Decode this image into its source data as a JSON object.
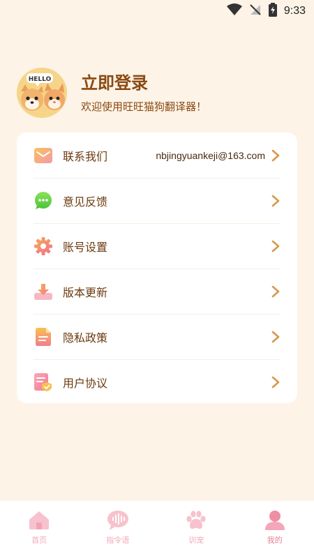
{
  "status_bar": {
    "time": "9:33"
  },
  "profile": {
    "avatar_text": "HELLO",
    "login_title": "立即登录",
    "welcome": "欢迎使用旺旺猫狗翻译器！"
  },
  "menu": {
    "items": [
      {
        "label": "联系我们",
        "value": "nbjingyuankeji@163.com",
        "icon": "mail-icon"
      },
      {
        "label": "意见反馈",
        "icon": "chat-icon"
      },
      {
        "label": "账号设置",
        "icon": "gear-icon"
      },
      {
        "label": "版本更新",
        "icon": "download-icon"
      },
      {
        "label": "隐私政策",
        "icon": "document-icon"
      },
      {
        "label": "用户协议",
        "icon": "agreement-icon"
      }
    ]
  },
  "tabs": [
    {
      "label": "首页",
      "icon": "home-icon"
    },
    {
      "label": "指令语",
      "icon": "voice-icon"
    },
    {
      "label": "训宠",
      "icon": "paw-icon"
    },
    {
      "label": "我的",
      "icon": "profile-icon",
      "active": true
    }
  ],
  "colors": {
    "background": "#fdf3e7",
    "text": "#6b3b10",
    "chevron": "#d9964c",
    "tab_inactive": "#f3a9b8",
    "tab_active": "#e87f98"
  }
}
